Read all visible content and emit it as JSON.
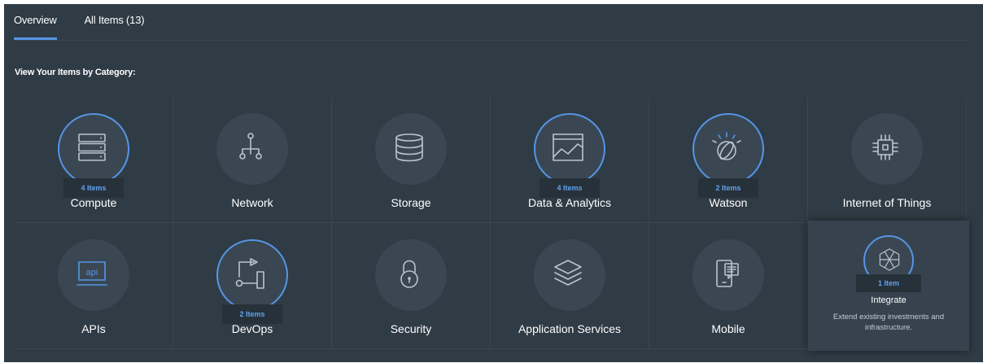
{
  "tabs": [
    {
      "label": "Overview",
      "active": true
    },
    {
      "label": "All Items (13)",
      "active": false
    }
  ],
  "heading": "View Your Items by Category:",
  "colors": {
    "accent": "#5596e6",
    "background": "#2f3b45",
    "tile_circle": "#3a4752",
    "badge_text": "#5fa2ee"
  },
  "categories": [
    {
      "label": "Compute",
      "badge": "4 Items",
      "icon": "server-icon"
    },
    {
      "label": "Network",
      "badge": "",
      "icon": "network-icon"
    },
    {
      "label": "Storage",
      "badge": "",
      "icon": "database-icon"
    },
    {
      "label": "Data & Analytics",
      "badge": "4 Items",
      "icon": "chart-window-icon"
    },
    {
      "label": "Watson",
      "badge": "2 Items",
      "icon": "watson-icon"
    },
    {
      "label": "Internet of Things",
      "badge": "",
      "icon": "chip-icon"
    },
    {
      "label": "APIs",
      "badge": "",
      "icon": "api-icon"
    },
    {
      "label": "DevOps",
      "badge": "2 Items",
      "icon": "pipeline-icon"
    },
    {
      "label": "Security",
      "badge": "",
      "icon": "lock-icon"
    },
    {
      "label": "Application Services",
      "badge": "",
      "icon": "layers-icon"
    },
    {
      "label": "Mobile",
      "badge": "",
      "icon": "mobile-icon"
    },
    {
      "label": "Integrate",
      "badge": "1 Item",
      "icon": "hexagon-icon",
      "description": "Extend existing investments and infrastructure."
    }
  ]
}
